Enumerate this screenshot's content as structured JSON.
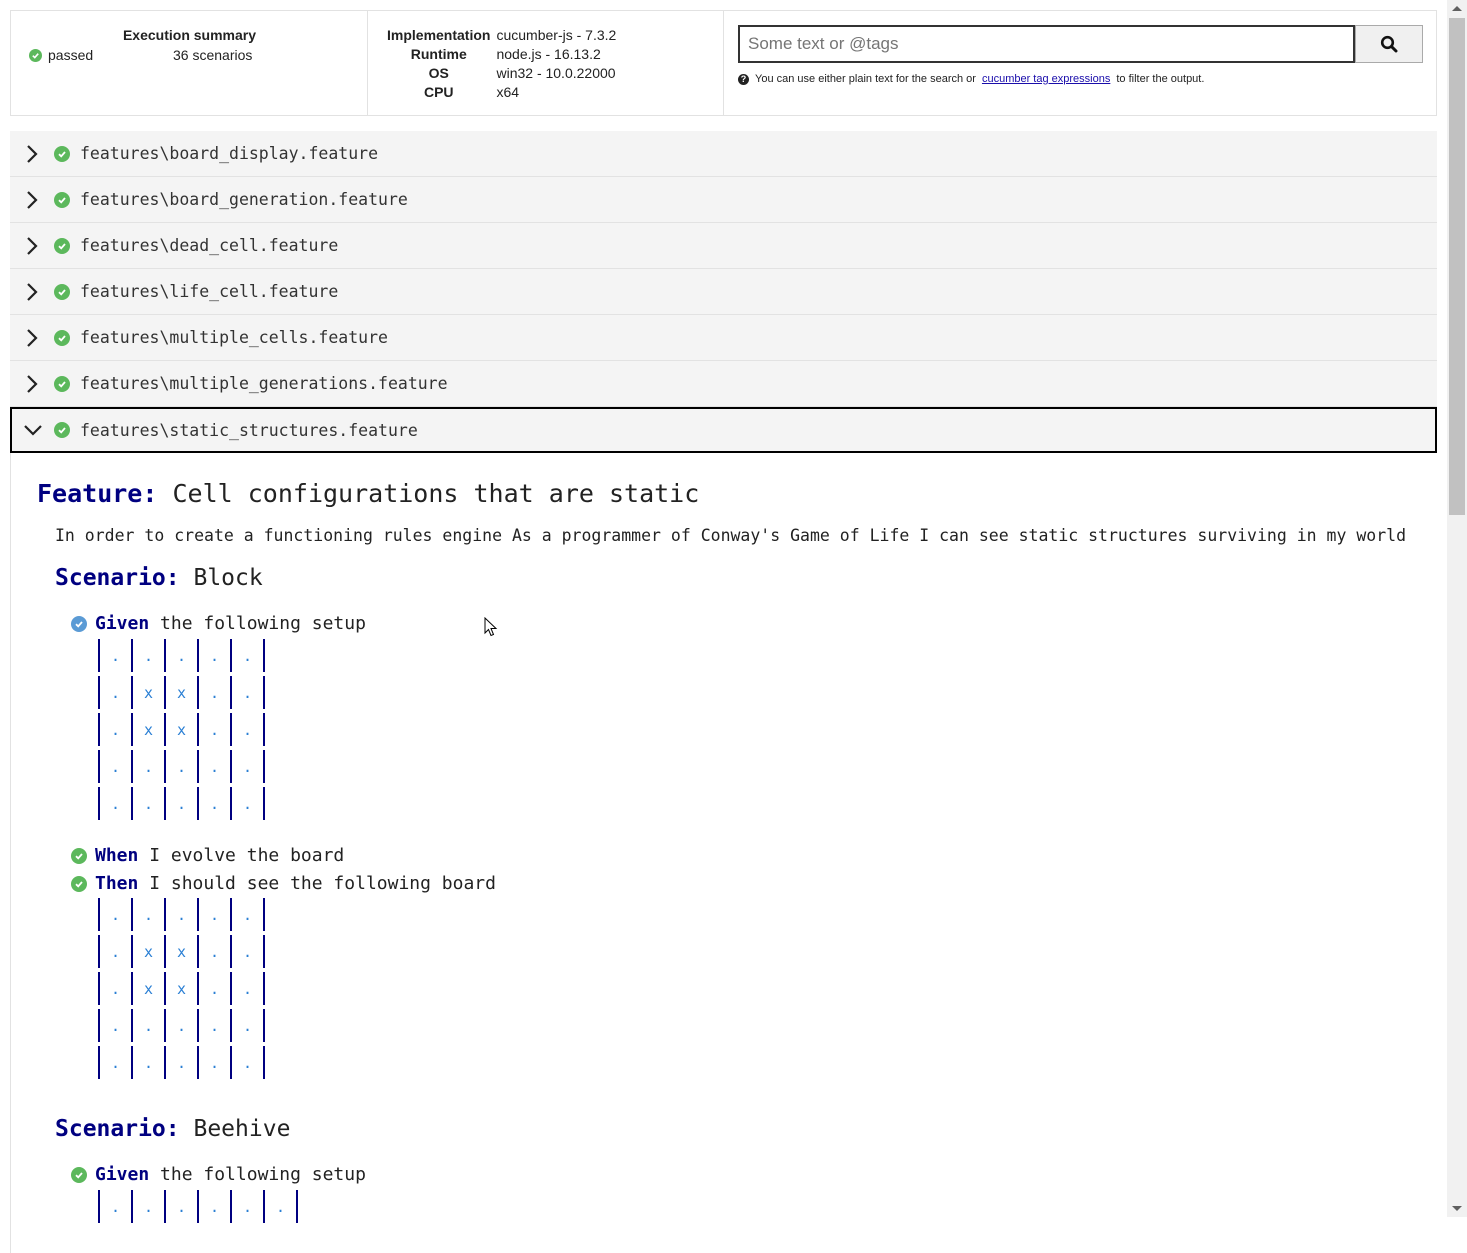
{
  "summary": {
    "title": "Execution summary",
    "status": "passed",
    "scenarios": "36 scenarios"
  },
  "environment": [
    {
      "key": "Implementation",
      "value": "cucumber-js - 7.3.2"
    },
    {
      "key": "Runtime",
      "value": "node.js - 16.13.2"
    },
    {
      "key": "OS",
      "value": "win32 - 10.0.22000"
    },
    {
      "key": "CPU",
      "value": "x64"
    }
  ],
  "search": {
    "placeholder": "Some text or @tags",
    "help_before": "You can use either plain text for the search or",
    "help_link": "cucumber tag expressions",
    "help_after": "to filter the output."
  },
  "features": [
    {
      "name": "features\\board_display.feature"
    },
    {
      "name": "features\\board_generation.feature"
    },
    {
      "name": "features\\dead_cell.feature"
    },
    {
      "name": "features\\life_cell.feature"
    },
    {
      "name": "features\\multiple_cells.feature"
    },
    {
      "name": "features\\multiple_generations.feature"
    },
    {
      "name": "features\\static_structures.feature"
    }
  ],
  "open_feature": {
    "keyword": "Feature:",
    "title": "Cell configurations that are static",
    "description": "In order to create a functioning rules engine As a programmer of Conway's Game of Life I can see static structures surviving in my world",
    "scenario_keyword": "Scenario:",
    "scenarios": [
      {
        "title": "Block",
        "steps": [
          {
            "keyword": "Given",
            "text": "the following setup"
          },
          {
            "keyword": "When",
            "text": "I evolve the board"
          },
          {
            "keyword": "Then",
            "text": "I should see the following board"
          }
        ],
        "setup": [
          [
            ".",
            ".",
            ".",
            ".",
            "."
          ],
          [
            ".",
            "x",
            "x",
            ".",
            "."
          ],
          [
            ".",
            "x",
            "x",
            ".",
            "."
          ],
          [
            ".",
            ".",
            ".",
            ".",
            "."
          ],
          [
            ".",
            ".",
            ".",
            ".",
            "."
          ]
        ],
        "result": [
          [
            ".",
            ".",
            ".",
            ".",
            "."
          ],
          [
            ".",
            "x",
            "x",
            ".",
            "."
          ],
          [
            ".",
            "x",
            "x",
            ".",
            "."
          ],
          [
            ".",
            ".",
            ".",
            ".",
            "."
          ],
          [
            ".",
            ".",
            ".",
            ".",
            "."
          ]
        ]
      },
      {
        "title": "Beehive",
        "steps": [
          {
            "keyword": "Given",
            "text": "the following setup"
          }
        ],
        "setup_first_row": [
          ".",
          ".",
          ".",
          ".",
          ".",
          "."
        ]
      }
    ]
  },
  "colors": {
    "keyword": "#000080",
    "cell": "#2a7fd4",
    "passed": "#5cb85c"
  }
}
